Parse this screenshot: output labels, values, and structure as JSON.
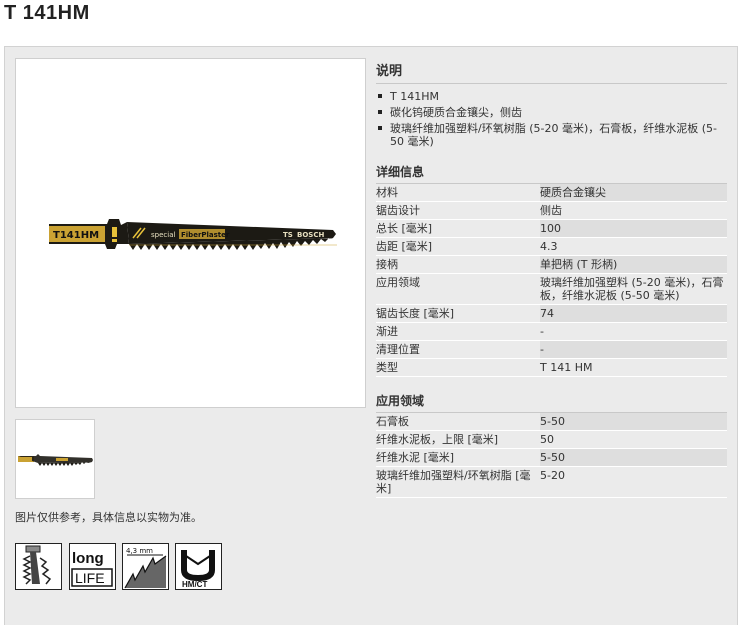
{
  "title": "T 141HM",
  "caption": "图片仅供参考，具体信息以实物为准。",
  "product_image_text": {
    "model": "T141HM",
    "line": "special",
    "series": "FiberPlaster",
    "count": "TS",
    "brand": "BOSCH"
  },
  "description": {
    "heading": "说明",
    "bullets": [
      "T 141HM",
      "碳化钨硬质合金镶尖，侧齿",
      "玻璃纤维加强塑料/环氧树脂 (5-20 毫米)，石膏板，纤维水泥板 (5-50 毫米)"
    ]
  },
  "details": {
    "heading": "详细信息",
    "rows": [
      {
        "k": "材料",
        "v": "硬质合金镶尖"
      },
      {
        "k": "锯齿设计",
        "v": "侧齿"
      },
      {
        "k": "总长 [毫米]",
        "v": "100"
      },
      {
        "k": "齿距 [毫米]",
        "v": "4.3"
      },
      {
        "k": "接柄",
        "v": "单把柄 (T 形柄)"
      },
      {
        "k": "应用领域",
        "v": "玻璃纤维加强塑料 (5-20 毫米)，石膏板，纤维水泥板 (5-50 毫米)"
      },
      {
        "k": "锯齿长度 [毫米]",
        "v": "74"
      },
      {
        "k": "渐进",
        "v": "-"
      },
      {
        "k": "清理位置",
        "v": "-"
      },
      {
        "k": "类型",
        "v": "T 141 HM"
      }
    ]
  },
  "applications": {
    "heading": "应用领域",
    "rows": [
      {
        "k": "石膏板",
        "v": "5-50"
      },
      {
        "k": "纤维水泥板，上限 [毫米]",
        "v": "50"
      },
      {
        "k": "纤维水泥 [毫米]",
        "v": "5-50"
      },
      {
        "k": "玻璃纤维加强塑料/环氧树脂 [毫米]",
        "v": "5-20"
      }
    ]
  },
  "feature_icons": [
    {
      "name": "side-set-teeth-icon",
      "text": ""
    },
    {
      "name": "long-life-icon",
      "text_top": "long",
      "text_bottom": "LIFE"
    },
    {
      "name": "tooth-pitch-icon",
      "text": "4,3 mm"
    },
    {
      "name": "hm-ct-icon",
      "text": "HM/CT"
    }
  ]
}
